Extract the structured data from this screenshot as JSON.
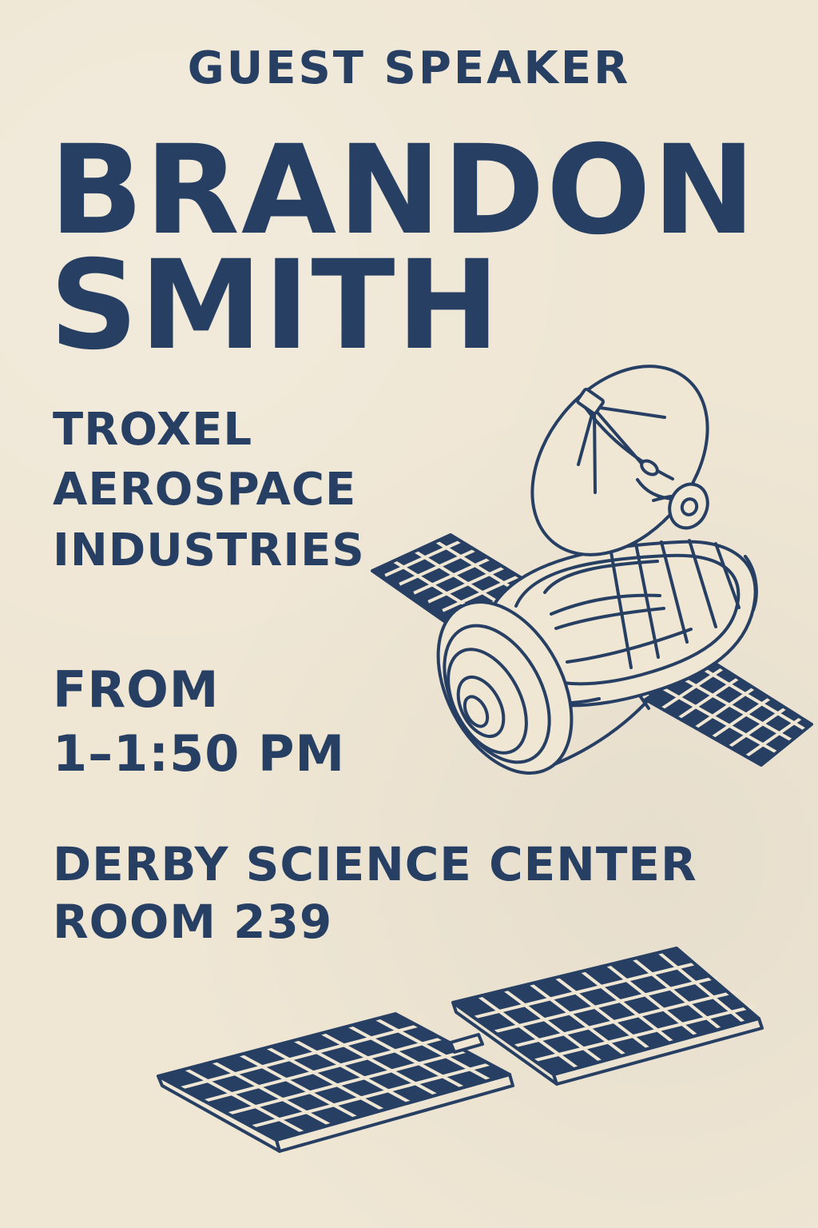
{
  "poster": {
    "eyebrow": "GUEST SPEAKER",
    "speaker": {
      "first": "BRANDON",
      "last": "SMITH"
    },
    "organization_lines": [
      "TROXEL",
      "AEROSPACE",
      "INDUSTRIES"
    ],
    "time_lines": [
      "FROM",
      "1–1:50 PM"
    ],
    "venue_lines": [
      "DERBY SCIENCE CENTER",
      "ROOM 239"
    ]
  },
  "colors": {
    "background": "#efe6d4",
    "ink": "#263f63"
  },
  "art": {
    "main_icon": "satellite-icon",
    "bottom_icon": "solar-panel-icon"
  }
}
